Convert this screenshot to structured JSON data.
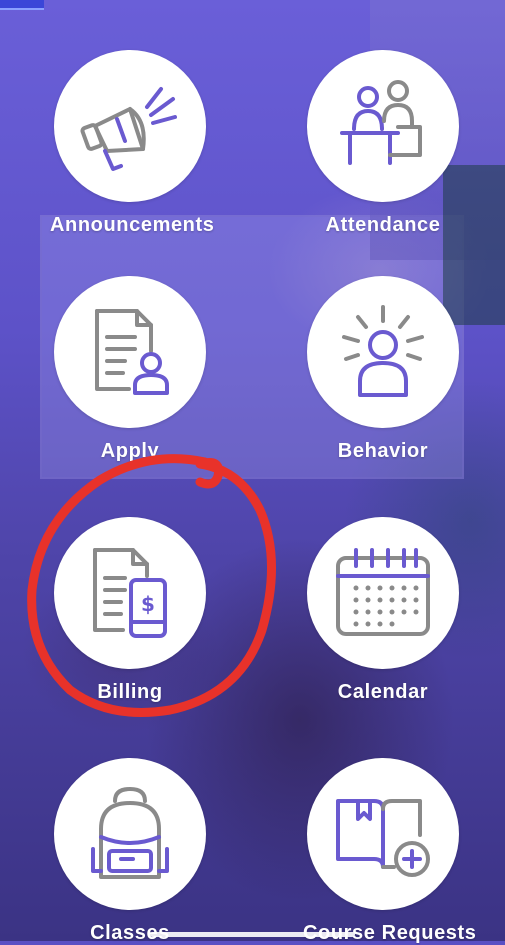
{
  "tiles": [
    {
      "label": "Announcements",
      "icon": "megaphone-icon"
    },
    {
      "label": "Attendance",
      "icon": "attendance-icon"
    },
    {
      "label": "Apply",
      "icon": "application-form-icon"
    },
    {
      "label": "Behavior",
      "icon": "behavior-person-icon"
    },
    {
      "label": "Billing",
      "icon": "billing-phone-invoice-icon"
    },
    {
      "label": "Calendar",
      "icon": "calendar-icon"
    },
    {
      "label": "Classes",
      "icon": "backpack-icon"
    },
    {
      "label": "Course Requests",
      "icon": "book-add-icon"
    }
  ],
  "colors": {
    "accent_purple": "#6a5ad0",
    "icon_gray": "#8a8a8a",
    "annotation_red": "#e8322a",
    "tile_bg": "#ffffff"
  }
}
